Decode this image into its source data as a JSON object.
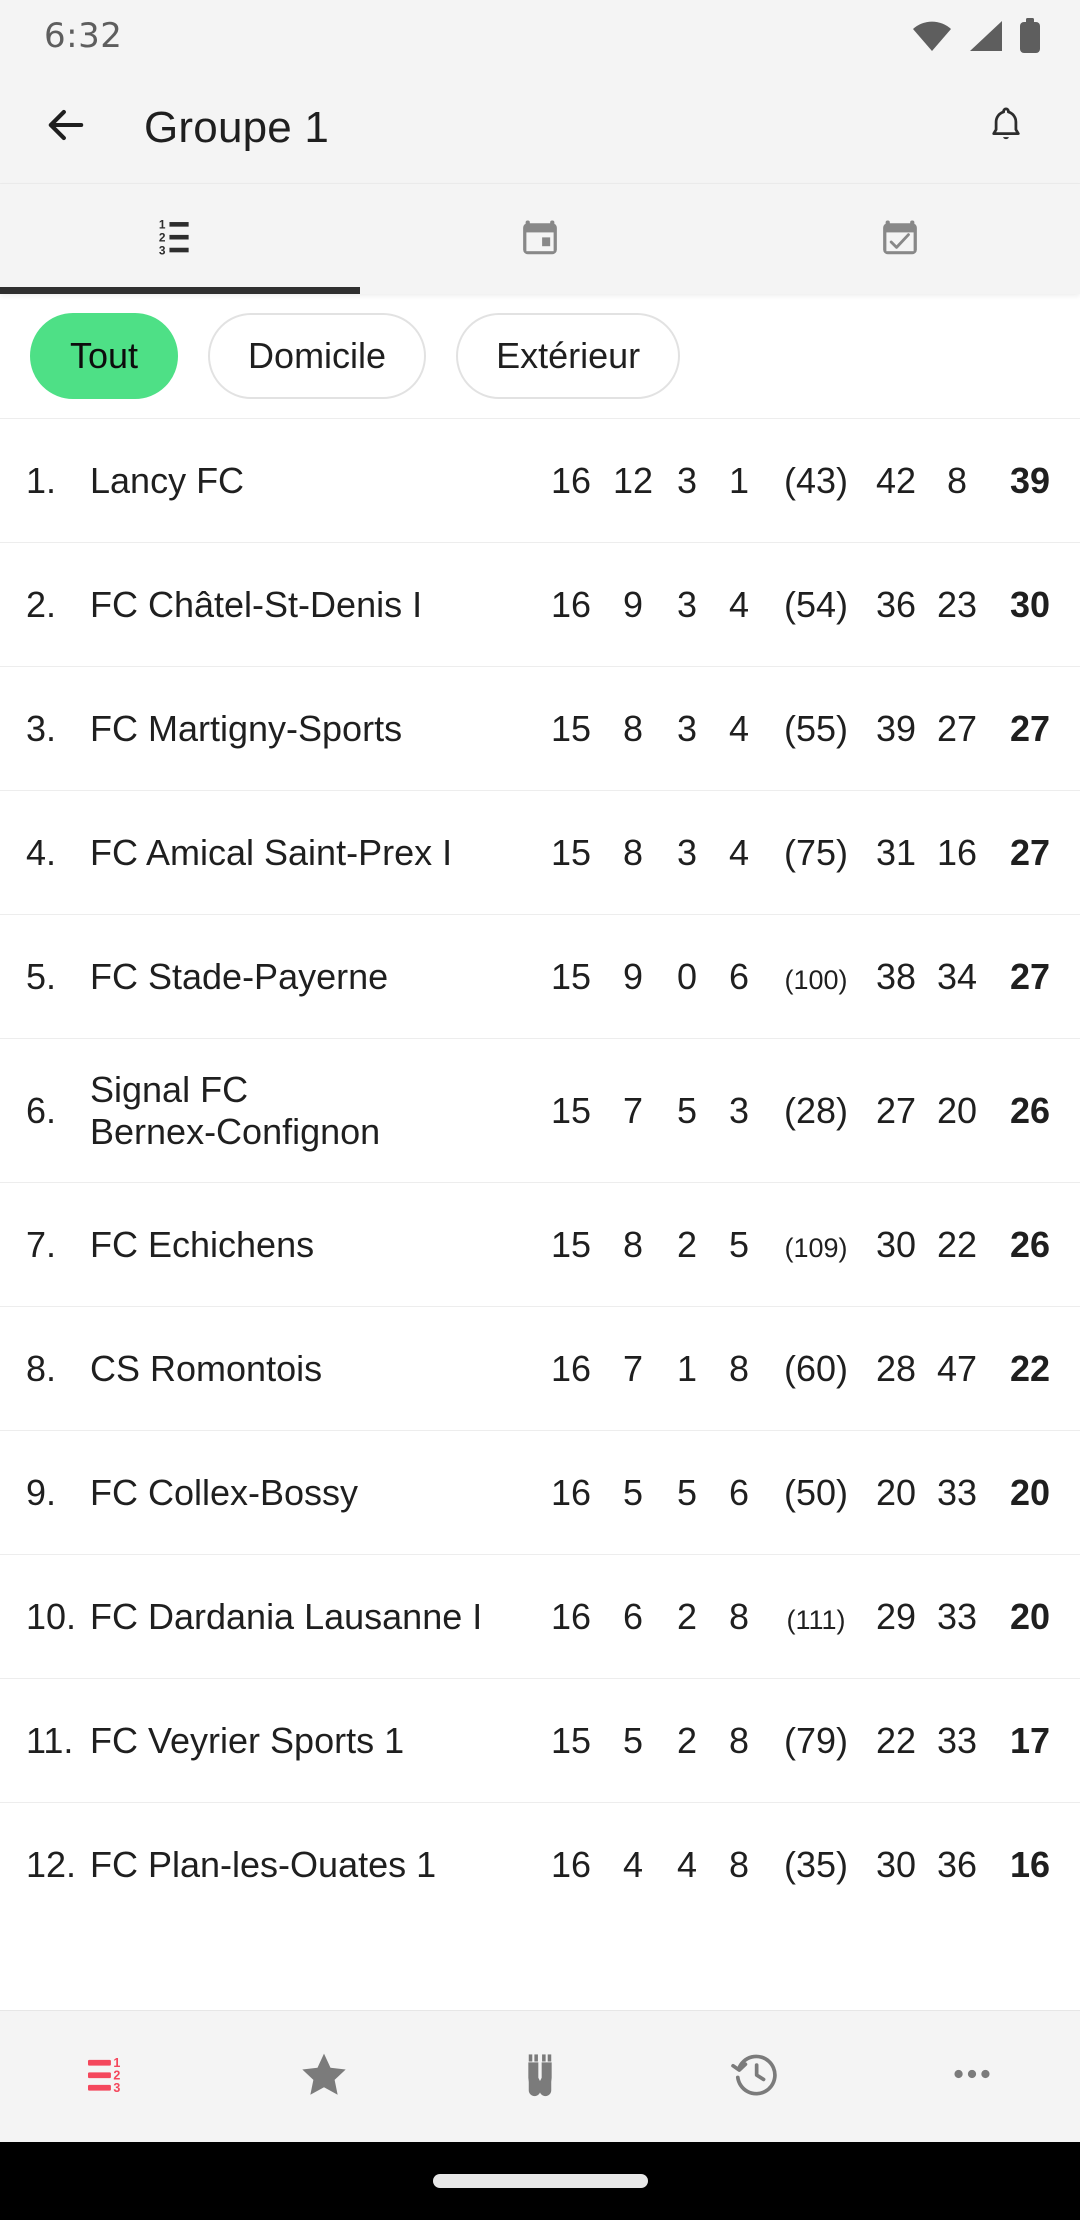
{
  "statusbar": {
    "time": "6:32",
    "icons": [
      "wifi-icon",
      "cellular-signal-icon",
      "battery-icon"
    ]
  },
  "appbar": {
    "back_icon": "arrow-back-icon",
    "title": "Groupe 1",
    "bell_icon": "notification-bell-icon"
  },
  "tabs": [
    {
      "name": "standings-tab",
      "icon": "numbered-list-icon",
      "selected": true
    },
    {
      "name": "fixtures-tab",
      "icon": "calendar-icon",
      "selected": false
    },
    {
      "name": "results-tab",
      "icon": "calendar-check-icon",
      "selected": false
    }
  ],
  "filters": {
    "chips": [
      {
        "label": "Tout",
        "selected": true
      },
      {
        "label": "Domicile",
        "selected": false
      },
      {
        "label": "Extérieur",
        "selected": false
      }
    ],
    "selected_color": "#4ee086"
  },
  "standings": {
    "rows": [
      {
        "rank": "1.",
        "team": "Lancy FC",
        "team2": "",
        "mj": "16",
        "v": "12",
        "n": "3",
        "d": "1",
        "pct": "(43)",
        "pct_small": false,
        "bp": "42",
        "bc": "8",
        "pts": "39"
      },
      {
        "rank": "2.",
        "team": "FC Châtel-St-Denis I",
        "team2": "",
        "mj": "16",
        "v": "9",
        "n": "3",
        "d": "4",
        "pct": "(54)",
        "pct_small": false,
        "bp": "36",
        "bc": "23",
        "pts": "30"
      },
      {
        "rank": "3.",
        "team": "FC Martigny-Sports",
        "team2": "",
        "mj": "15",
        "v": "8",
        "n": "3",
        "d": "4",
        "pct": "(55)",
        "pct_small": false,
        "bp": "39",
        "bc": "27",
        "pts": "27"
      },
      {
        "rank": "4.",
        "team": "FC Amical Saint-Prex I",
        "team2": "",
        "mj": "15",
        "v": "8",
        "n": "3",
        "d": "4",
        "pct": "(75)",
        "pct_small": false,
        "bp": "31",
        "bc": "16",
        "pts": "27"
      },
      {
        "rank": "5.",
        "team": "FC Stade-Payerne",
        "team2": "",
        "mj": "15",
        "v": "9",
        "n": "0",
        "d": "6",
        "pct": "(100)",
        "pct_small": true,
        "bp": "38",
        "bc": "34",
        "pts": "27"
      },
      {
        "rank": "6.",
        "team": "Signal FC",
        "team2": "Bernex-Confignon",
        "mj": "15",
        "v": "7",
        "n": "5",
        "d": "3",
        "pct": "(28)",
        "pct_small": false,
        "bp": "27",
        "bc": "20",
        "pts": "26"
      },
      {
        "rank": "7.",
        "team": "FC Echichens",
        "team2": "",
        "mj": "15",
        "v": "8",
        "n": "2",
        "d": "5",
        "pct": "(109)",
        "pct_small": true,
        "bp": "30",
        "bc": "22",
        "pts": "26"
      },
      {
        "rank": "8.",
        "team": "CS Romontois",
        "team2": "",
        "mj": "16",
        "v": "7",
        "n": "1",
        "d": "8",
        "pct": "(60)",
        "pct_small": false,
        "bp": "28",
        "bc": "47",
        "pts": "22"
      },
      {
        "rank": "9.",
        "team": "FC Collex-Bossy",
        "team2": "",
        "mj": "16",
        "v": "5",
        "n": "5",
        "d": "6",
        "pct": "(50)",
        "pct_small": false,
        "bp": "20",
        "bc": "33",
        "pts": "20"
      },
      {
        "rank": "10.",
        "team": "FC Dardania Lausanne I",
        "team2": "",
        "mj": "16",
        "v": "6",
        "n": "2",
        "d": "8",
        "pct": "(111)",
        "pct_small": true,
        "bp": "29",
        "bc": "33",
        "pts": "20"
      },
      {
        "rank": "11.",
        "team": "FC Veyrier Sports 1",
        "team2": "",
        "mj": "15",
        "v": "5",
        "n": "2",
        "d": "8",
        "pct": "(79)",
        "pct_small": false,
        "bp": "22",
        "bc": "33",
        "pts": "17"
      },
      {
        "rank": "12.",
        "team": "FC Plan-les-Ouates 1",
        "team2": "",
        "mj": "16",
        "v": "4",
        "n": "4",
        "d": "8",
        "pct": "(35)",
        "pct_small": false,
        "bp": "30",
        "bc": "36",
        "pts": "16"
      }
    ]
  },
  "bottomnav": {
    "items": [
      {
        "name": "nav-standings",
        "icon": "numbered-list-icon",
        "active": true,
        "color": "#f4475c"
      },
      {
        "name": "nav-favorites",
        "icon": "star-icon",
        "active": false,
        "color": "#7b7b7b"
      },
      {
        "name": "nav-scout",
        "icon": "binoculars-icon",
        "active": false,
        "color": "#7b7b7b"
      },
      {
        "name": "nav-history",
        "icon": "history-clock-icon",
        "active": false,
        "color": "#7b7b7b"
      },
      {
        "name": "nav-more",
        "icon": "more-dots-icon",
        "active": false,
        "color": "#7b7b7b"
      }
    ]
  }
}
